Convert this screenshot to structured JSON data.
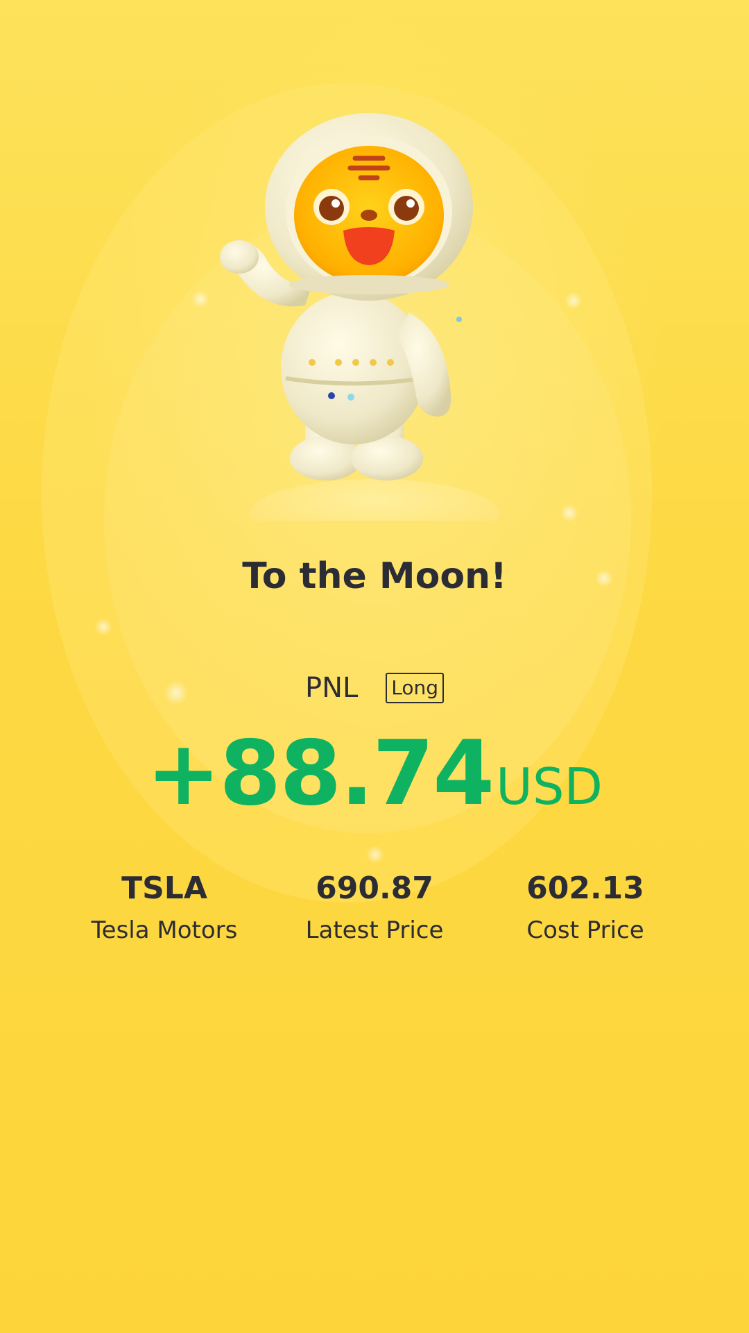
{
  "headline": "To the Moon!",
  "pnl": {
    "label": "PNL",
    "direction": "Long",
    "amount": "+88.74",
    "currency": "USD",
    "color": "#0fb260"
  },
  "stats": [
    {
      "value": "TSLA",
      "label": "Tesla Motors"
    },
    {
      "value": "690.87",
      "label": "Latest Price"
    },
    {
      "value": "602.13",
      "label": "Cost Price"
    }
  ],
  "colors": {
    "background": "#fdd93a",
    "text": "#2c2c34",
    "profit": "#0fb260"
  },
  "illustration": "tiger-astronaut-mascot"
}
